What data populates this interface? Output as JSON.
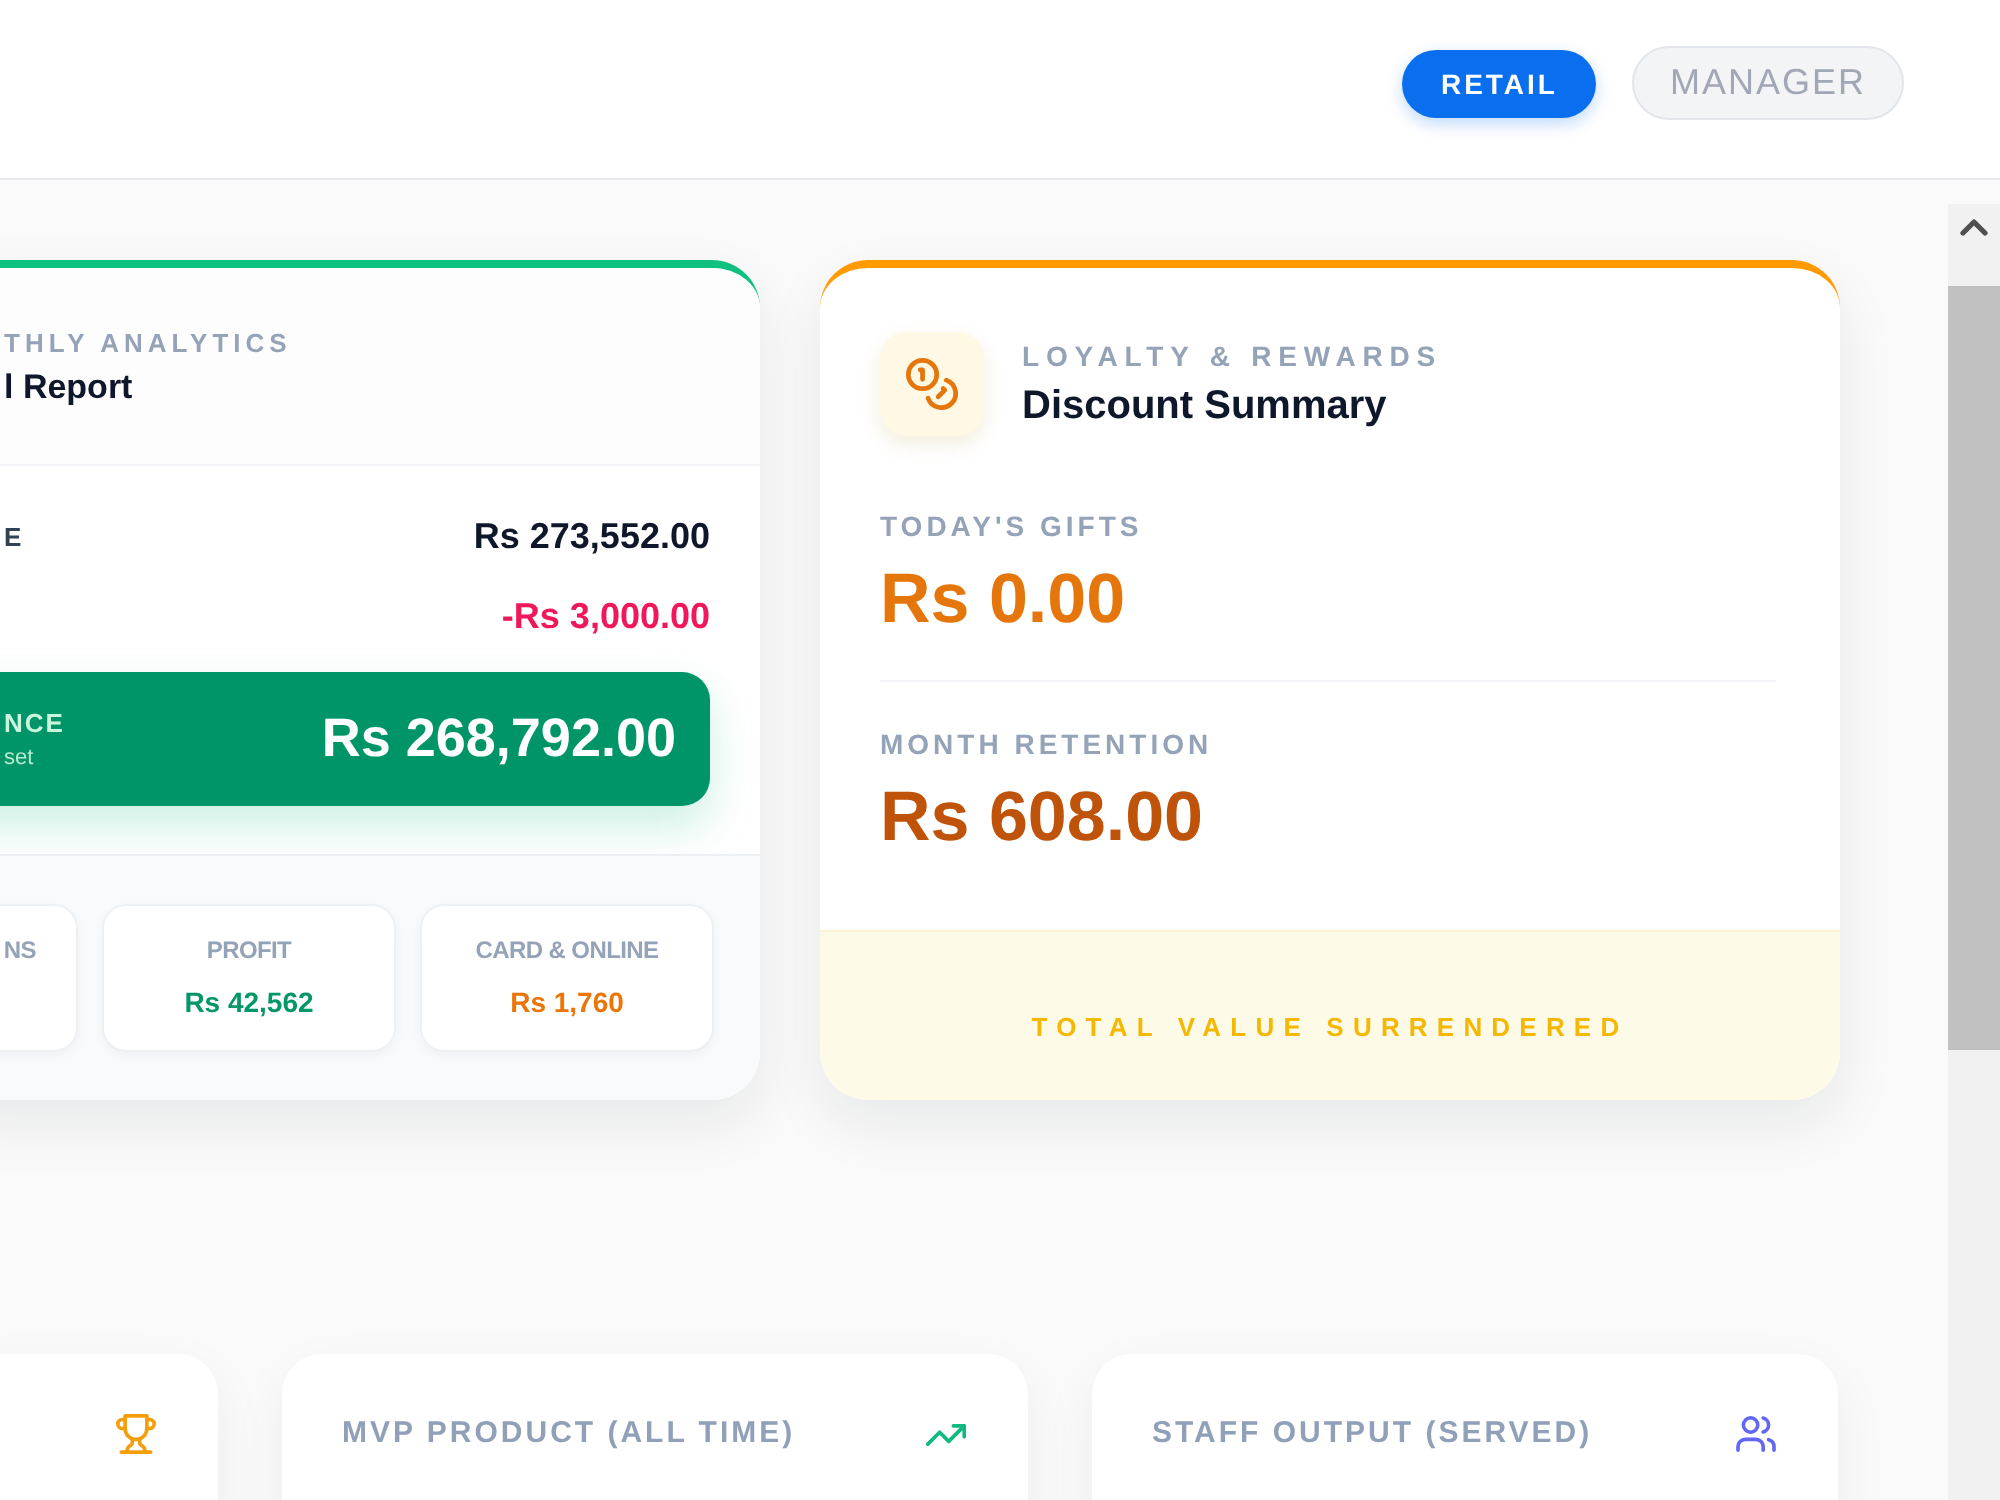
{
  "header": {
    "tabs": [
      {
        "label": "RETAIL",
        "selected": true
      },
      {
        "label": "MANAGER",
        "selected": false
      }
    ]
  },
  "analytics_card": {
    "eyebrow": "THLY ANALYTICS",
    "title": "l Report",
    "rows": [
      {
        "label": "E",
        "value": "Rs 273,552.00",
        "kind": "total"
      },
      {
        "value": "-Rs 3,000.00",
        "kind": "deduction"
      }
    ],
    "balance": {
      "label": "NCE",
      "note": "set",
      "value": "Rs 268,792.00"
    },
    "stats": [
      {
        "label": "NS"
      },
      {
        "label": "PROFIT",
        "value": "Rs 42,562",
        "color": "#059669"
      },
      {
        "label": "CARD & ONLINE",
        "value": "Rs 1,760",
        "color": "#ea760a"
      }
    ]
  },
  "discount_card": {
    "eyebrow": "LOYALTY & REWARDS",
    "title": "Discount Summary",
    "metrics": [
      {
        "label": "TODAY'S GIFTS",
        "value": "Rs 0.00",
        "color": "#e5760b"
      },
      {
        "label": "MONTH RETENTION",
        "value": "Rs 608.00",
        "color": "#c0530a"
      }
    ],
    "footer": "TOTAL VALUE SURRENDERED"
  },
  "panels": [
    {
      "kind": "partial"
    },
    {
      "kind": "full",
      "title": "MVP PRODUCT (ALL TIME)"
    },
    {
      "kind": "full",
      "title": "STAFF OUTPUT (SERVED)"
    }
  ]
}
